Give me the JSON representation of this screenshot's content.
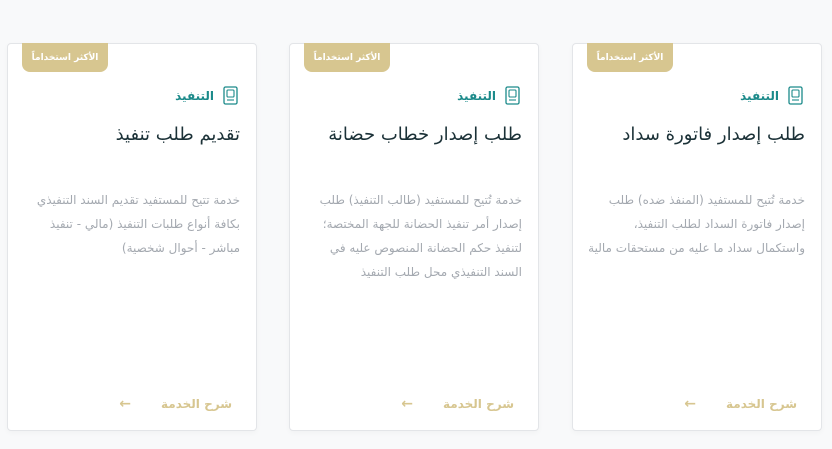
{
  "cards": [
    {
      "badge": "الأكثر استخداماً",
      "category": "التنفيذ",
      "title": "طلب إصدار فاتورة سداد",
      "desc": "خدمة تُتيح للمستفيد (المنفذ ضده) طلب إصدار فاتورة السداد لطلب التنفيذ، واستكمال سداد ما عليه من مستحقات مالية",
      "explain": "شرح الخدمة"
    },
    {
      "badge": "الأكثر استخداماً",
      "category": "التنفيذ",
      "title": "طلب إصدار خطاب حضانة",
      "desc": "خدمة تُتيح للمستفيد (طالب التنفيذ) طلب إصدار أمر تنفيذ الحضانة للجهة المختصة؛ لتنفيذ حكم الحضانة المنصوص عليه في السند التنفيذي محل طلب التنفيذ",
      "explain": "شرح الخدمة"
    },
    {
      "badge": "الأكثر استخداماً",
      "category": "التنفيذ",
      "title": "تقديم طلب تنفيذ",
      "desc": "خدمة تتيح للمستفيد تقديم السند التنفيذي بكافة أنواع طلبات التنفيذ (مالي - تنفيذ مباشر - أحوال شخصية)",
      "explain": "شرح الخدمة"
    }
  ]
}
